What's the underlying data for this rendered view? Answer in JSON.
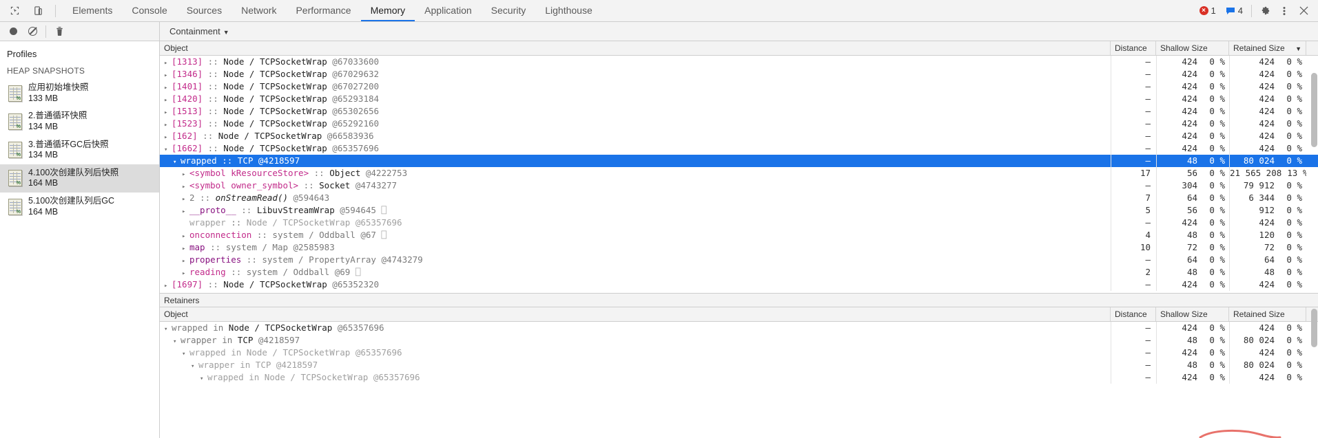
{
  "window": {
    "tabs": [
      {
        "label": "Elements",
        "active": false
      },
      {
        "label": "Console",
        "active": false
      },
      {
        "label": "Sources",
        "active": false
      },
      {
        "label": "Network",
        "active": false
      },
      {
        "label": "Performance",
        "active": false
      },
      {
        "label": "Memory",
        "active": true
      },
      {
        "label": "Application",
        "active": false
      },
      {
        "label": "Security",
        "active": false
      },
      {
        "label": "Lighthouse",
        "active": false
      }
    ],
    "inspect_icon": "inspect-element-icon",
    "device_icon": "device-toolbar-icon",
    "errors": {
      "icon": "error-icon",
      "count": "1"
    },
    "messages": {
      "icon": "message-icon",
      "count": "4"
    },
    "settings_icon": "gear-icon",
    "more_icon": "more-vertical-icon",
    "close_icon": "close-icon"
  },
  "toolbar": {
    "record_icon": "record-circle-icon",
    "clear_icon": "clear-no-entry-icon",
    "delete_icon": "trash-icon",
    "view_select": "Containment",
    "view_caret": "▼"
  },
  "sidebar": {
    "title": "Profiles",
    "section": "HEAP SNAPSHOTS",
    "items": [
      {
        "name": "应用初始堆快照",
        "size": "133 MB",
        "selected": false
      },
      {
        "name": "2.普通循环快照",
        "size": "134 MB",
        "selected": false
      },
      {
        "name": "3.普通循环GC后快照",
        "size": "134 MB",
        "selected": false
      },
      {
        "name": "4.100次创建队列后快照",
        "size": "164 MB",
        "selected": true
      },
      {
        "name": "5.100次创建队列后GC",
        "size": "164 MB",
        "selected": false
      }
    ]
  },
  "columns": {
    "object": "Object",
    "distance": "Distance",
    "shallow": "Shallow Size",
    "retained": "Retained Size",
    "sort_caret": "▼"
  },
  "containment": {
    "rows": [
      {
        "indent": 0,
        "tw": "▸",
        "kind": "index",
        "idx": "[1313]",
        "sep": " :: ",
        "cls": "Node / TCPSocketWrap",
        "addr": "@67033600",
        "distance": "–",
        "shallow": "424",
        "shallow_pct": "0 %",
        "retained": "424",
        "retained_pct": "0 %",
        "selected": false
      },
      {
        "indent": 0,
        "tw": "▸",
        "kind": "index",
        "idx": "[1346]",
        "sep": " :: ",
        "cls": "Node / TCPSocketWrap",
        "addr": "@67029632",
        "distance": "–",
        "shallow": "424",
        "shallow_pct": "0 %",
        "retained": "424",
        "retained_pct": "0 %",
        "selected": false
      },
      {
        "indent": 0,
        "tw": "▸",
        "kind": "index",
        "idx": "[1401]",
        "sep": " :: ",
        "cls": "Node / TCPSocketWrap",
        "addr": "@67027200",
        "distance": "–",
        "shallow": "424",
        "shallow_pct": "0 %",
        "retained": "424",
        "retained_pct": "0 %",
        "selected": false
      },
      {
        "indent": 0,
        "tw": "▸",
        "kind": "index",
        "idx": "[1420]",
        "sep": " :: ",
        "cls": "Node / TCPSocketWrap",
        "addr": "@65293184",
        "distance": "–",
        "shallow": "424",
        "shallow_pct": "0 %",
        "retained": "424",
        "retained_pct": "0 %",
        "selected": false
      },
      {
        "indent": 0,
        "tw": "▸",
        "kind": "index",
        "idx": "[1513]",
        "sep": " :: ",
        "cls": "Node / TCPSocketWrap",
        "addr": "@65302656",
        "distance": "–",
        "shallow": "424",
        "shallow_pct": "0 %",
        "retained": "424",
        "retained_pct": "0 %",
        "selected": false
      },
      {
        "indent": 0,
        "tw": "▸",
        "kind": "index",
        "idx": "[1523]",
        "sep": " :: ",
        "cls": "Node / TCPSocketWrap",
        "addr": "@65292160",
        "distance": "–",
        "shallow": "424",
        "shallow_pct": "0 %",
        "retained": "424",
        "retained_pct": "0 %",
        "selected": false
      },
      {
        "indent": 0,
        "tw": "▸",
        "kind": "index",
        "idx": "[162]",
        "sep": " :: ",
        "cls": "Node / TCPSocketWrap",
        "addr": "@66583936",
        "distance": "–",
        "shallow": "424",
        "shallow_pct": "0 %",
        "retained": "424",
        "retained_pct": "0 %",
        "selected": false
      },
      {
        "indent": 0,
        "tw": "▾",
        "kind": "index",
        "idx": "[1662]",
        "sep": " :: ",
        "cls": "Node / TCPSocketWrap",
        "addr": "@65357696",
        "distance": "–",
        "shallow": "424",
        "shallow_pct": "0 %",
        "retained": "424",
        "retained_pct": "0 %",
        "selected": false
      },
      {
        "indent": 1,
        "tw": "▾",
        "kind": "prop",
        "idx": "wrapped",
        "sep": " :: ",
        "cls": "TCP",
        "addr": "@4218597",
        "distance": "–",
        "shallow": "48",
        "shallow_pct": "0 %",
        "retained": "80 024",
        "retained_pct": "0 %",
        "selected": true
      },
      {
        "indent": 2,
        "tw": "▸",
        "kind": "prop",
        "idx": "<symbol kResourceStore>",
        "sep": " :: ",
        "cls": "Object",
        "addr": "@4222753",
        "distance": "17",
        "shallow": "56",
        "shallow_pct": "0 %",
        "retained": "21 565 208",
        "retained_pct": "13 %",
        "selected": false
      },
      {
        "indent": 2,
        "tw": "▸",
        "kind": "prop",
        "idx": "<symbol owner_symbol>",
        "sep": " :: ",
        "cls": "Socket",
        "addr": "@4743277",
        "distance": "–",
        "shallow": "304",
        "shallow_pct": "0 %",
        "retained": "79 912",
        "retained_pct": "0 %",
        "selected": false
      },
      {
        "indent": 2,
        "tw": "▸",
        "kind": "fn",
        "idx": "2",
        "sep": " :: ",
        "cls": "onStreamRead()",
        "addr": "@594643",
        "distance": "7",
        "shallow": "64",
        "shallow_pct": "0 %",
        "retained": "6 344",
        "retained_pct": "0 %",
        "selected": false
      },
      {
        "indent": 2,
        "tw": "▸",
        "kind": "proto",
        "idx": "__proto__",
        "sep": " :: ",
        "cls": "LibuvStreamWrap",
        "addr": "@594645",
        "box": "⎕",
        "distance": "5",
        "shallow": "56",
        "shallow_pct": "0 %",
        "retained": "912",
        "retained_pct": "0 %",
        "selected": false
      },
      {
        "indent": 2,
        "tw": " ",
        "kind": "dim",
        "idx": "wrapper",
        "sep": " :: ",
        "cls": "Node / TCPSocketWrap",
        "addr": "@65357696",
        "distance": "–",
        "shallow": "424",
        "shallow_pct": "0 %",
        "retained": "424",
        "retained_pct": "0 %",
        "selected": false
      },
      {
        "indent": 2,
        "tw": "▸",
        "kind": "prop",
        "idx": "onconnection",
        "sep": " :: ",
        "cls": "system / Oddball",
        "addr": "@67",
        "box": "⎕",
        "distance": "4",
        "shallow": "48",
        "shallow_pct": "0 %",
        "retained": "120",
        "retained_pct": "0 %",
        "selected": false
      },
      {
        "indent": 2,
        "tw": "▸",
        "kind": "sysprop",
        "idx": "map",
        "sep": " :: ",
        "cls": "system / Map",
        "addr": "@2585983",
        "distance": "10",
        "shallow": "72",
        "shallow_pct": "0 %",
        "retained": "72",
        "retained_pct": "0 %",
        "selected": false
      },
      {
        "indent": 2,
        "tw": "▸",
        "kind": "sysprop",
        "idx": "properties",
        "sep": " :: ",
        "cls": "system / PropertyArray",
        "addr": "@4743279",
        "distance": "–",
        "shallow": "64",
        "shallow_pct": "0 %",
        "retained": "64",
        "retained_pct": "0 %",
        "selected": false
      },
      {
        "indent": 2,
        "tw": "▸",
        "kind": "prop",
        "idx": "reading",
        "sep": " :: ",
        "cls": "system / Oddball",
        "addr": "@69",
        "box": "⎕",
        "distance": "2",
        "shallow": "48",
        "shallow_pct": "0 %",
        "retained": "48",
        "retained_pct": "0 %",
        "selected": false
      },
      {
        "indent": 0,
        "tw": "▸",
        "kind": "index",
        "idx": "[1697]",
        "sep": " :: ",
        "cls": "Node / TCPSocketWrap",
        "addr": "@65352320",
        "distance": "–",
        "shallow": "424",
        "shallow_pct": "0 %",
        "retained": "424",
        "retained_pct": "0 %",
        "selected": false
      }
    ]
  },
  "retainers": {
    "title": "Retainers",
    "rows": [
      {
        "indent": 0,
        "tw": "▾",
        "name": "wrapped",
        "rel": " in ",
        "cls": "Node / TCPSocketWrap",
        "addr": "@65357696",
        "dim": false,
        "distance": "–",
        "shallow": "424",
        "shallow_pct": "0 %",
        "retained": "424",
        "retained_pct": "0 %"
      },
      {
        "indent": 1,
        "tw": "▾",
        "name": "wrapper",
        "rel": " in ",
        "cls": "TCP",
        "addr": "@4218597",
        "dim": false,
        "distance": "–",
        "shallow": "48",
        "shallow_pct": "0 %",
        "retained": "80 024",
        "retained_pct": "0 %"
      },
      {
        "indent": 2,
        "tw": "▾",
        "name": "wrapped",
        "rel": " in ",
        "cls": "Node / TCPSocketWrap",
        "addr": "@65357696",
        "dim": true,
        "distance": "–",
        "shallow": "424",
        "shallow_pct": "0 %",
        "retained": "424",
        "retained_pct": "0 %"
      },
      {
        "indent": 3,
        "tw": "▾",
        "name": "wrapper",
        "rel": " in ",
        "cls": "TCP",
        "addr": "@4218597",
        "dim": true,
        "distance": "–",
        "shallow": "48",
        "shallow_pct": "0 %",
        "retained": "80 024",
        "retained_pct": "0 %"
      },
      {
        "indent": 4,
        "tw": "▾",
        "name": "wrapped",
        "rel": " in ",
        "cls": "Node / TCPSocketWrap",
        "addr": "@65357696",
        "dim": true,
        "distance": "–",
        "shallow": "424",
        "shallow_pct": "0 %",
        "retained": "424",
        "retained_pct": "0 %"
      }
    ]
  }
}
